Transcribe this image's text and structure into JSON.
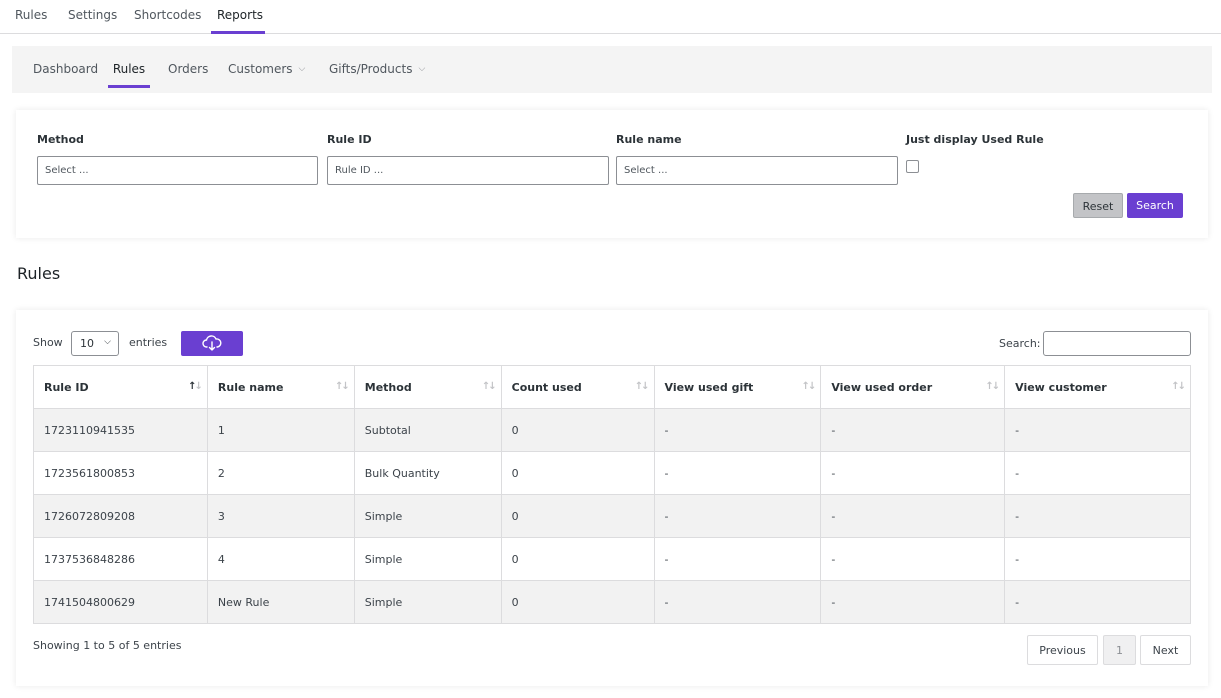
{
  "top_tabs": [
    "Rules",
    "Settings",
    "Shortcodes",
    "Reports"
  ],
  "sub_tabs": [
    "Dashboard",
    "Rules",
    "Orders",
    "Customers",
    "Gifts/Products"
  ],
  "filters": {
    "method_label": "Method",
    "method_placeholder": "Select ...",
    "rule_id_label": "Rule ID",
    "rule_id_placeholder": "Rule ID ...",
    "rule_name_label": "Rule name",
    "rule_name_placeholder": "Select ...",
    "used_rule_label": "Just display Used Rule",
    "reset_label": "Reset",
    "search_label": "Search"
  },
  "section_title": "Rules",
  "table_controls": {
    "show_label": "Show",
    "entries_value": "10",
    "entries_label": "entries",
    "search_label": "Search:"
  },
  "table": {
    "columns": [
      "Rule ID",
      "Rule name",
      "Method",
      "Count used",
      "View used gift",
      "View used order",
      "View customer"
    ],
    "rows": [
      [
        "1723110941535",
        "1",
        "Subtotal",
        "0",
        "-",
        "-",
        "-"
      ],
      [
        "1723561800853",
        "2",
        "Bulk Quantity",
        "0",
        "-",
        "-",
        "-"
      ],
      [
        "1726072809208",
        "3",
        "Simple",
        "0",
        "-",
        "-",
        "-"
      ],
      [
        "1737536848286",
        "4",
        "Simple",
        "0",
        "-",
        "-",
        "-"
      ],
      [
        "1741504800629",
        "New Rule",
        "Simple",
        "0",
        "-",
        "-",
        "-"
      ]
    ]
  },
  "footer": {
    "info": "Showing 1 to 5 of 5 entries",
    "previous_label": "Previous",
    "current_page": "1",
    "next_label": "Next"
  },
  "colors": {
    "accent": "#6a3fd1"
  }
}
